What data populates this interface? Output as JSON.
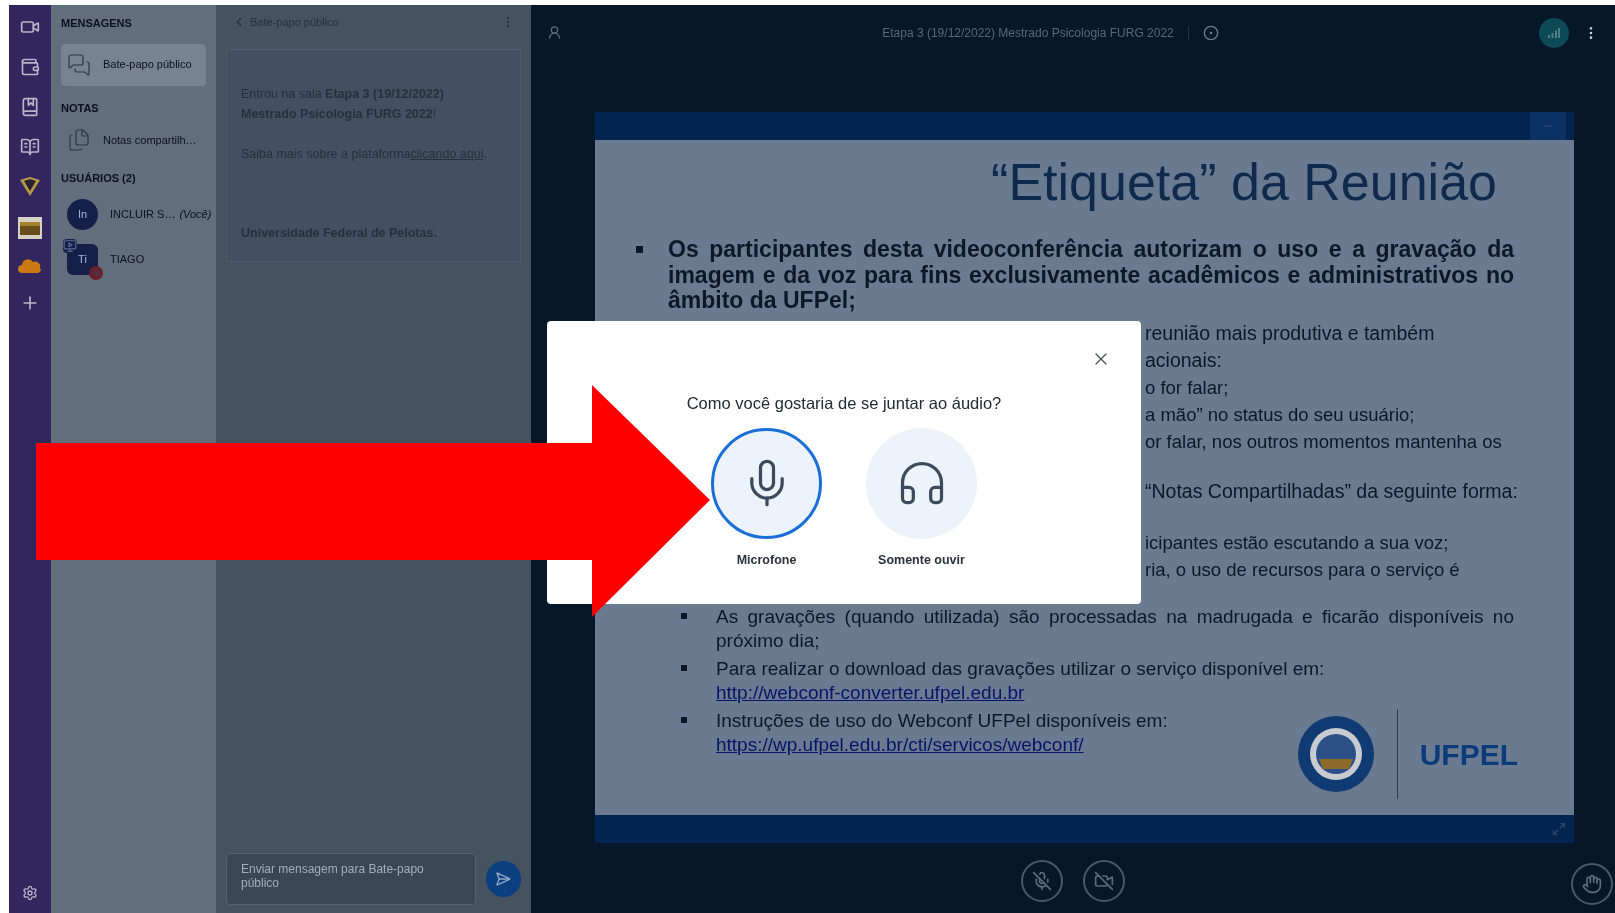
{
  "sidebar": {
    "messages": {
      "heading": "MENSAGENS",
      "items": [
        {
          "label": "Bate-papo público",
          "selected": true
        }
      ]
    },
    "notes": {
      "heading": "NOTAS",
      "items": [
        {
          "label": "Notas compartilh…"
        }
      ]
    },
    "users": {
      "heading": "USUÁRIOS (2)",
      "items": [
        {
          "initials": "In",
          "name": "INCLUIR S…",
          "you_label": "(Você)",
          "kind": "viewer",
          "presenter": false,
          "muted": false
        },
        {
          "initials": "Ti",
          "name": "TIAGO",
          "kind": "moderator",
          "presenter": true,
          "muted": true
        }
      ]
    }
  },
  "chat": {
    "title": "Bate-papo público",
    "welcome": "Entrou na sala **Etapa 3 (19/12/2022) Mestrado Psicologia FURG 2022**!",
    "info_text": "Saiba mais sobre a plataforma ",
    "info_link": "clicando aqui",
    "info_end": ".",
    "footer": "Universidade Federal de Pelotas.",
    "input": {
      "placeholder": "Enviar mensagem para Bate-papo público"
    }
  },
  "main": {
    "title": "Etapa 3 (19/12/2022) Mestrado Psicologia FURG 2022",
    "slide": {
      "title": "“Etiqueta” da Reunião",
      "first_bullet": "Os participantes desta videoconferência autorizam o uso e a gravação da imagem e da voz para fins exclusivamente acadêmicos e administrativos no âmbito da UFPel;",
      "partial_lines": [
        {
          "text": "reunião mais produtiva e também",
          "kind": "bullet"
        },
        {
          "text": "acionais:",
          "kind": "bullet"
        },
        {
          "text": "o for falar;",
          "kind": "sub"
        },
        {
          "text": "a mão” no status do seu usuário;",
          "kind": "sub"
        },
        {
          "text": "or falar, nos outros momentos mantenha os",
          "kind": "sub"
        },
        {
          "text": "“Notas Compartilhadas” da seguinte forma:",
          "kind": "bullet"
        },
        {
          "text": "icipantes estão escutando a sua voz;",
          "kind": "sub"
        },
        {
          "text": "ria, o uso de recursos para o serviço é",
          "kind": "sub"
        }
      ],
      "sub_bullets": [
        {
          "text": "As gravações (quando utilizada) são processadas na madrugada e ficarão disponíveis no próximo dia;"
        },
        {
          "text": "Para realizar o download das gravações utilizar o serviço disponível em:",
          "link": "http://webconf-converter.ufpel.edu.br"
        },
        {
          "text": "Instruções de uso do Webconf UFPel disponíveis em:",
          "link": "https://wp.ufpel.edu.br/cti/servicos/webconf/"
        }
      ],
      "logo_text": "UFPEL"
    }
  },
  "audio_modal": {
    "question": "Como você gostaria de se juntar ao áudio?",
    "options": [
      {
        "label": "Microfone",
        "kind": "microphone",
        "selected": true
      },
      {
        "label": "Somente ouvir",
        "kind": "listen",
        "selected": false
      }
    ]
  }
}
